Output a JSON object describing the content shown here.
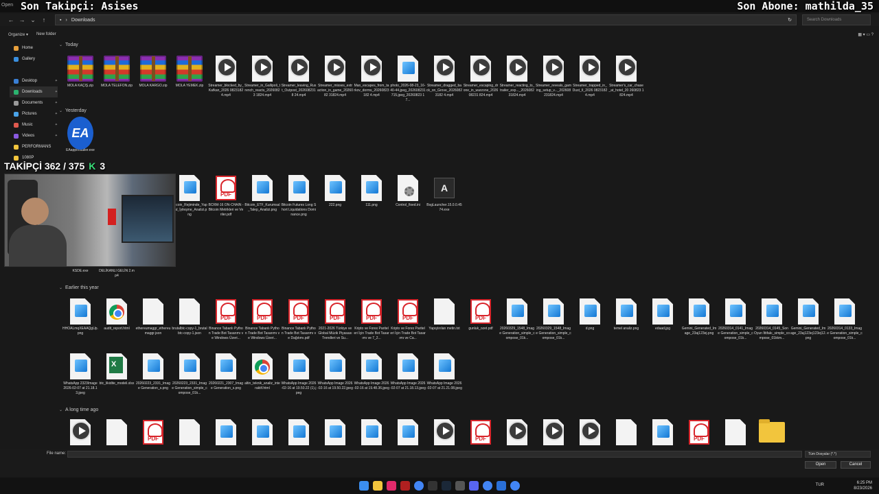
{
  "overlay": {
    "left": "Son Takipçi: Asises",
    "right": "Son Abone: mathilda_35",
    "follower": "TAKİPÇİ 362 / 375",
    "follower_k": "K",
    "follower_n": "3"
  },
  "window": {
    "title": "Open"
  },
  "address": {
    "path": "Downloads",
    "search_placeholder": "Search Downloads"
  },
  "cmdbar": {
    "organize": "Organize ▾",
    "new_folder": "New folder"
  },
  "sidebar": {
    "items": [
      {
        "label": "Home",
        "color": "#e8a03c",
        "pin": false
      },
      {
        "label": "Gallery",
        "color": "#3a8fde",
        "pin": false
      },
      {
        "label": "Desktop",
        "color": "#3a7fd4",
        "pin": true
      },
      {
        "label": "Downloads",
        "color": "#2bb36f",
        "pin": true
      },
      {
        "label": "Documents",
        "color": "#9a9a9a",
        "pin": true
      },
      {
        "label": "Pictures",
        "color": "#4aa3e8",
        "pin": true
      },
      {
        "label": "Music",
        "color": "#e05a4f",
        "pin": true
      },
      {
        "label": "Videos",
        "color": "#8a5ae0",
        "pin": true
      },
      {
        "label": "PERFORMANS",
        "color": "#f2c53d",
        "pin": false
      },
      {
        "label": "1080P",
        "color": "#f2c53d",
        "pin": false
      }
    ]
  },
  "groups": {
    "today": "Today",
    "yesterday": "Yesterday",
    "earlier": "Earlier this year",
    "long": "A long time ago"
  },
  "today_files": [
    {
      "name": "MOLA KAÇIŞ.zip",
      "type": "rar"
    },
    {
      "name": "MOLA TELEFON.zip",
      "type": "rar"
    },
    {
      "name": "MOLA KARGO.zip",
      "type": "rar"
    },
    {
      "name": "MOLA YEMEK.zip",
      "type": "rar"
    },
    {
      "name": "Streamer_blocked_by_Kafkan_2026 08231824.mp4",
      "type": "video"
    },
    {
      "name": "Streamer_in_Gallipoli_trench_reacts_20260823 1824.mp4",
      "type": "video"
    },
    {
      "name": "Streamer_leaving_Rust_Outpost_2026082318 24.mp4",
      "type": "video"
    },
    {
      "name": "Streamer_misses_extraction_in_game_2026082 31824.mp4",
      "type": "video"
    },
    {
      "name": "Man_escapes_from_tarkov_dorms_20260823182 4.mp4",
      "type": "video"
    },
    {
      "name": "photo_2026-08-23_16-40-44.jpeg_202608231715.jpeg_20260823 17...",
      "type": "image"
    },
    {
      "name": "Streamer_dragged_back_on_Grove_20260823182 4.mp4",
      "type": "video"
    },
    {
      "name": "Streamer_escaping_drone_in_warzone_202608231 824.mp4",
      "type": "video"
    },
    {
      "name": "Streamer_reacting_to_trailer_exp..._202608231824.mp4",
      "type": "video"
    },
    {
      "name": "Streamer_reveals_gaming_setup_v..._202608231824.mp4",
      "type": "video"
    },
    {
      "name": "Streamer_trapped_in_Dust_II_2026 08231824.mp4",
      "type": "video"
    },
    {
      "name": "Streamer's_car_chase_at_hotel_20 260823 1824.mp4",
      "type": "video"
    }
  ],
  "yesterday_files": [
    {
      "name": "EAappInstaller.exe",
      "type": "ea",
      "glyph": "EA"
    },
    {
      "name": "Bitcoin_Rejiminde_Yapısal_İyileşme_Analizi.png",
      "type": "image"
    },
    {
      "name": "BCRM-16 ON-CHAIN - Bitcoin Metrikleri ve Veriler.pdf",
      "type": "pdf"
    },
    {
      "name": "Bitcoin_ETF_Kurumsal_Talep_Analizi.png",
      "type": "image"
    },
    {
      "name": "Bitcoin Futures Long Short Liquidations Dominance.png",
      "type": "image"
    },
    {
      "name": "222.png",
      "type": "image"
    },
    {
      "name": "111.png",
      "type": "image"
    },
    {
      "name": "Control_fixed.ini",
      "type": "ini"
    },
    {
      "name": "BsgLauncher.15.0.0.4574.exe",
      "type": "exe",
      "glyph": "A"
    },
    {
      "name": "KSDE.exe",
      "type": "blank"
    },
    {
      "name": "DELİKANLI GELİN 2.mp4",
      "type": "blank"
    }
  ],
  "earlier_files": [
    {
      "name": "HHOALmqXEAAQgUp.png",
      "type": "image"
    },
    {
      "name": "audit_report.html",
      "type": "chrome"
    },
    {
      "name": "ethereumaggr_ethereumaggr.json",
      "type": "doc"
    },
    {
      "name": "brutalbtc-copy-1_brutalbtc-copy-1.json",
      "type": "doc"
    },
    {
      "name": "Binance Tabanlı Python Trade Bot Tasarımı ve Windows Üzeri...",
      "type": "pdf"
    },
    {
      "name": "Binance Tabanlı Python Trade Bot Tasarımı ve Windows Üzeri...",
      "type": "pdf"
    },
    {
      "name": "Binance Tabanlı Python Trade Bot Tasarımı ve Dağıtımı.pdf",
      "type": "pdf"
    },
    {
      "name": "2021-2026 Türkiye ve Global Müzik Piyasası Trendleri ve Su...",
      "type": "pdf"
    },
    {
      "name": "Kripto ve Forex Pariteleri İçin Trade Bot Tasarımı ve 7_2...",
      "type": "pdf"
    },
    {
      "name": "Kripto ve Forex Pariteleri İçin Trade Bot Tasarımı ve Ca...",
      "type": "pdf"
    },
    {
      "name": "Yapıştırılan metin.txt",
      "type": "doc"
    },
    {
      "name": "gunluk_ozet.pdf",
      "type": "pdf"
    },
    {
      "name": "20260329_1548_Image Generation_simple_compose_01k...",
      "type": "image"
    },
    {
      "name": "20260329_1548_Image Generation_simple_compose_01k...",
      "type": "image"
    },
    {
      "name": "d.png",
      "type": "image"
    },
    {
      "name": "temel analiz.png",
      "type": "image"
    },
    {
      "name": "edaad.jpg",
      "type": "image"
    },
    {
      "name": "Gemini_Generated_Image_23aj123ej.png",
      "type": "image"
    },
    {
      "name": "20260314_0141_Image Generation_simple_compose_01k...",
      "type": "image"
    },
    {
      "name": "20260314_0145_Son Oyun İttifakı_simple_compose_01kkm...",
      "type": "image"
    },
    {
      "name": "Gemini_Generated_Image_23aj123ej123ej12.png",
      "type": "image"
    },
    {
      "name": "20260314_0133_Image Generation_simple_compose_01k...",
      "type": "image"
    }
  ],
  "earlier_files_row2": [
    {
      "name": "WhatsApp 2323Image 2026-02-07 at 21.18.13.jpeg",
      "type": "image"
    },
    {
      "name": "btc_likidite_modeli.xlsx",
      "type": "xls",
      "glyph": "X"
    },
    {
      "name": "20260223_2331_Image Generation_s.png",
      "type": "image"
    },
    {
      "name": "20260223_2331_Image Generation_simple_compose_01k...",
      "type": "image"
    },
    {
      "name": "20260221_2307_Image Generation_s.png",
      "type": "image"
    },
    {
      "name": "altin_teknik_analiz_interaktif.html",
      "type": "chrome"
    },
    {
      "name": "WhatsApp Image 2026-02-16 at 19.50.22 (1).jpeg",
      "type": "image"
    },
    {
      "name": "WhatsApp Image 2026-02-16 at 19.50.22.jpeg",
      "type": "image"
    },
    {
      "name": "WhatsApp Image 2026-02-16 at 19.48.36.jpeg",
      "type": "image"
    },
    {
      "name": "WhatsApp Image 2026-02-07 at 21.18.13.jpeg",
      "type": "image"
    },
    {
      "name": "WhatsApp Image 2026-02-07 at 21.21.08.jpeg",
      "type": "image"
    }
  ],
  "long_files": [
    {
      "type": "video"
    },
    {
      "type": "doc"
    },
    {
      "type": "pdf"
    },
    {
      "type": "doc"
    },
    {
      "type": "image"
    },
    {
      "type": "image"
    },
    {
      "type": "image"
    },
    {
      "type": "image"
    },
    {
      "type": "image"
    },
    {
      "type": "image"
    },
    {
      "type": "video"
    },
    {
      "type": "pdf"
    },
    {
      "type": "video"
    },
    {
      "type": "video"
    },
    {
      "type": "video"
    },
    {
      "type": "doc"
    },
    {
      "type": "image"
    },
    {
      "type": "pdf"
    },
    {
      "type": "doc"
    },
    {
      "type": "folder"
    }
  ],
  "pdf_label": "PDF",
  "bottom": {
    "filename_label": "File name:",
    "filter": "Tüm Dosyalar (*.*)",
    "open": "Open",
    "cancel": "Cancel"
  },
  "tray": {
    "lang": "TUR",
    "time": "6:25 PM",
    "date": "8/23/2026"
  }
}
